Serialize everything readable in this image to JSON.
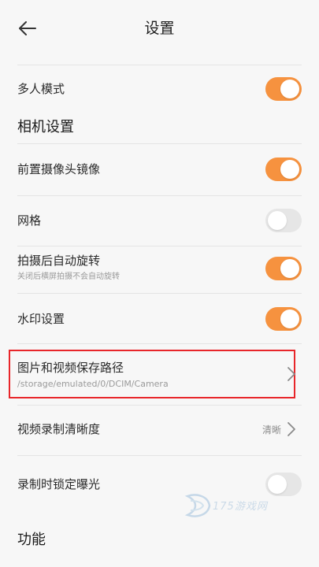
{
  "header": {
    "title": "设置",
    "back_icon": "arrow-left-icon"
  },
  "rows": [
    {
      "label": "多人模式",
      "toggle": "on"
    },
    {
      "section": "相机设置"
    },
    {
      "label": "前置摄像头镜像",
      "toggle": "on"
    },
    {
      "label": "网格",
      "toggle": "off"
    },
    {
      "label": "拍摄后自动旋转",
      "sublabel": "关闭后横屏拍摄不会自动旋转",
      "toggle": "on"
    },
    {
      "label": "水印设置",
      "toggle": "on"
    },
    {
      "label": "图片和视频保存路径",
      "sublabel": "/storage/emulated/0/DCIM/Camera",
      "chevron": true
    },
    {
      "label": "视频录制清晰度",
      "value": "清晰",
      "chevron": true
    },
    {
      "label": "录制时锁定曝光",
      "toggle": "off"
    },
    {
      "section": "功能"
    }
  ],
  "watermark": {
    "text": "175游戏网"
  },
  "colors": {
    "toggle_on": "#f6923f",
    "toggle_off": "#e6e6e6",
    "highlight": "#e8262a"
  }
}
